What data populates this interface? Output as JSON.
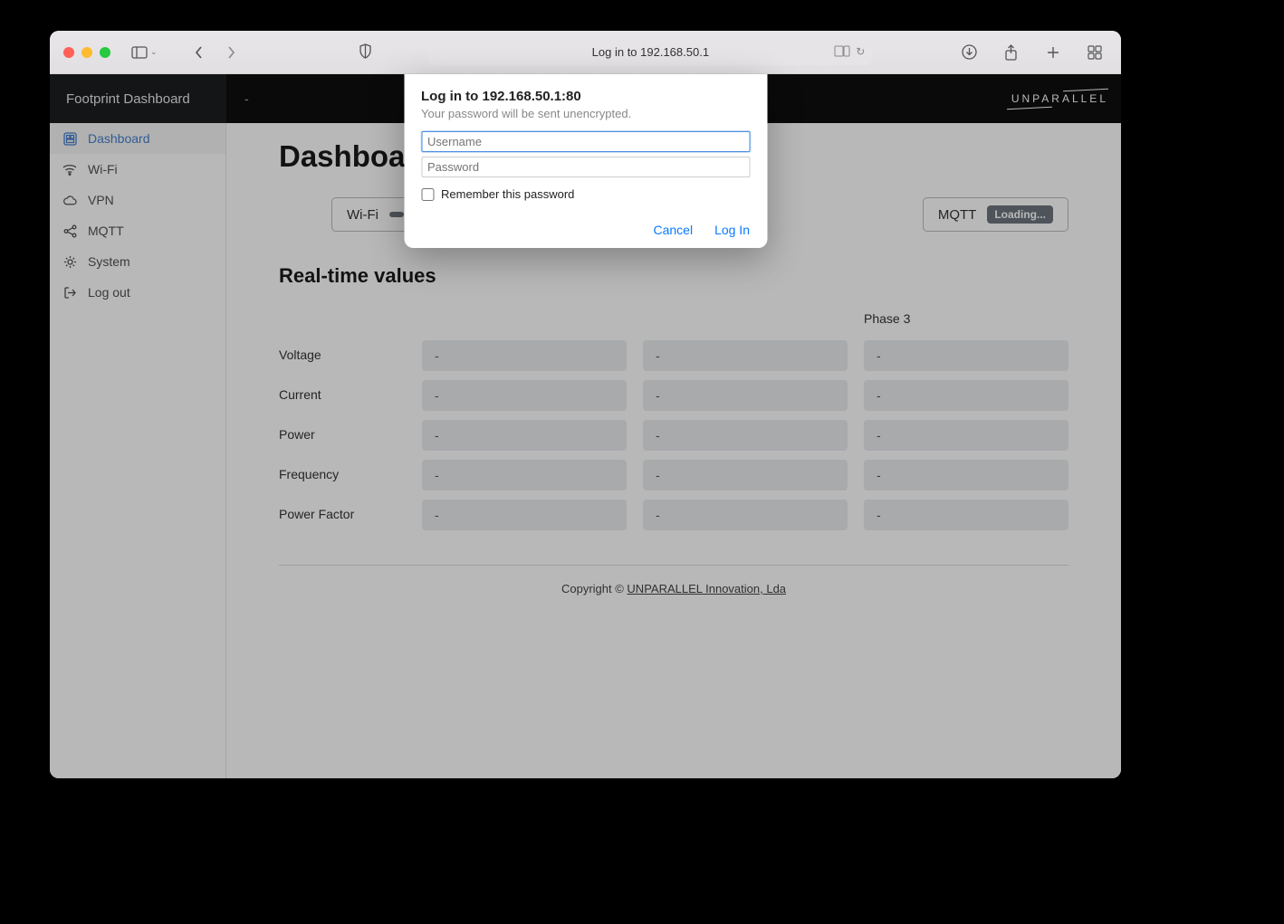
{
  "browser": {
    "url_display": "Log in to 192.168.50.1"
  },
  "topbar": {
    "brand": "Footprint Dashboard",
    "brand_dash": "-",
    "logo_text": "UNPARALLEL"
  },
  "sidebar": {
    "items": [
      {
        "label": "Dashboard"
      },
      {
        "label": "Wi-Fi"
      },
      {
        "label": "VPN"
      },
      {
        "label": "MQTT"
      },
      {
        "label": "System"
      },
      {
        "label": "Log out"
      }
    ]
  },
  "page": {
    "title": "Dashboard",
    "statuses": [
      {
        "name": "Wi-Fi",
        "badge": ""
      },
      {
        "name": "MQTT",
        "badge": "Loading..."
      }
    ],
    "realtime_title": "Real-time values",
    "phases": [
      "Phase 3"
    ],
    "metrics": [
      "Voltage",
      "Current",
      "Power",
      "Frequency",
      "Power Factor"
    ],
    "placeholder_val": "-"
  },
  "footer": {
    "pre": "Copyright © ",
    "link": "UNPARALLEL Innovation, Lda"
  },
  "dialog": {
    "title": "Log in to 192.168.50.1:80",
    "subtitle": "Your password will be sent unencrypted.",
    "username_ph": "Username",
    "password_ph": "Password",
    "remember_label": "Remember this password",
    "cancel": "Cancel",
    "login": "Log In"
  }
}
